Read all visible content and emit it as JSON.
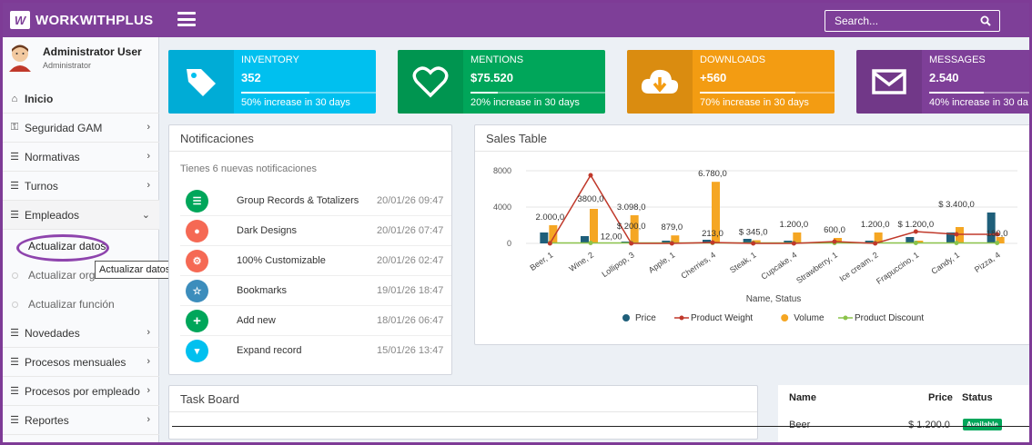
{
  "header": {
    "logo_text": "WORKWITHPLUS",
    "search_placeholder": "Search..."
  },
  "sidebar": {
    "user_name": "Administrator User",
    "user_role": "Administrator",
    "items": [
      {
        "label": "Inicio",
        "icon": "home-icon"
      },
      {
        "label": "Seguridad GAM",
        "icon": "key-icon"
      },
      {
        "label": "Normativas",
        "icon": "list-icon"
      },
      {
        "label": "Turnos",
        "icon": "list-icon"
      },
      {
        "label": "Empleados",
        "icon": "list-icon"
      },
      {
        "label": "Novedades",
        "icon": "list-icon"
      },
      {
        "label": "Procesos mensuales",
        "icon": "list-icon"
      },
      {
        "label": "Procesos por empleado",
        "icon": "list-icon"
      },
      {
        "label": "Reportes",
        "icon": "list-icon"
      }
    ],
    "subitems": [
      "Actualizar datos",
      "Actualizar orga",
      "Actualizar función"
    ],
    "tooltip": "Actualizar datos"
  },
  "info_boxes": [
    {
      "title": "INVENTORY",
      "value": "352",
      "desc": "50% increase in 30 days",
      "progress": 0.5,
      "color": "#00c0ef",
      "icon": "tag-icon"
    },
    {
      "title": "MENTIONS",
      "value": "$75.520",
      "desc": "20% increase in 30 days",
      "progress": 0.2,
      "color": "#00a65a",
      "icon": "heart-icon"
    },
    {
      "title": "DOWNLOADS",
      "value": "+560",
      "desc": "70% increase in 30 days",
      "progress": 0.7,
      "color": "#f39c12",
      "icon": "cloud-download-icon"
    },
    {
      "title": "MESSAGES",
      "value": "2.540",
      "desc": "40% increase in 30 da",
      "progress": 0.4,
      "color": "#7e3f98",
      "icon": "envelope-icon"
    }
  ],
  "notifications": {
    "title": "Notificaciones",
    "intro": "Tienes 6 nuevas notificaciones",
    "items": [
      {
        "text": "Group Records & Totalizers",
        "date": "20/01/26 09:47",
        "color": "#00a65a",
        "icon": "layers-icon"
      },
      {
        "text": "Dark Designs",
        "date": "20/01/26 07:47",
        "color": "#f56954",
        "icon": "palette-icon"
      },
      {
        "text": "100% Customizable",
        "date": "20/01/26 02:47",
        "color": "#f56954",
        "icon": "gear-icon"
      },
      {
        "text": "Bookmarks",
        "date": "19/01/26 18:47",
        "color": "#3c8dbc",
        "icon": "star-icon"
      },
      {
        "text": "Add new",
        "date": "18/01/26 06:47",
        "color": "#00a65a",
        "icon": "plus-icon"
      },
      {
        "text": "Expand record",
        "date": "15/01/26 13:47",
        "color": "#00c0ef",
        "icon": "chevron-down-icon"
      }
    ]
  },
  "sales": {
    "title": "Sales Table"
  },
  "chart_data": {
    "type": "bar",
    "categories": [
      "Beer, 1",
      "Wine, 2",
      "Lollipop, 3",
      "Apple, 1",
      "Cherries, 4",
      "Steak, 1",
      "Cupcake, 4",
      "Strawberry, 1",
      "Ice cream, 2",
      "Frapuccino, 1",
      "Candy, 1",
      "Pizza, 4"
    ],
    "xlabel": "Name, Status",
    "ylabel": "",
    "ylim": [
      0,
      8000
    ],
    "yticks": [
      "8000",
      "4000",
      "0"
    ],
    "series": [
      {
        "name": "Price",
        "type": "bar",
        "color": "#1f5f7a",
        "values": [
          1200,
          800,
          200,
          300,
          400,
          500,
          300,
          200,
          300,
          700,
          1200,
          3400
        ]
      },
      {
        "name": "Product Weight",
        "type": "line",
        "color": "#c0392b",
        "values": [
          0,
          7500,
          0,
          0,
          100,
          0,
          0,
          200,
          0,
          1300,
          1000,
          1000
        ]
      },
      {
        "name": "Volume",
        "type": "bar",
        "color": "#f5a623",
        "values": [
          2000,
          3800,
          3098,
          879,
          6780,
          345,
          1200,
          600,
          1200,
          300,
          1800,
          700
        ]
      },
      {
        "name": "Product Discount",
        "type": "line",
        "color": "#8bc34a",
        "values": [
          50,
          50,
          50,
          50,
          50,
          50,
          50,
          50,
          50,
          50,
          50,
          50
        ]
      }
    ],
    "data_labels": [
      "2.000,0",
      "3800,0",
      "3.098,0",
      "$ 200,0",
      "12,00",
      "879,0",
      "6.780,0",
      "213,0",
      "$ 345,0",
      "1.200,0",
      "600,0",
      "1.200,0",
      "$ 1.200,0",
      "$ 3.400,0",
      "180,0"
    ]
  },
  "task_board": {
    "title": "Task Board"
  },
  "right_table": {
    "headers": [
      "Name",
      "Price",
      "Status"
    ],
    "row": {
      "name": "Beer",
      "price": "$ 1.200.0",
      "status": "Available"
    }
  }
}
